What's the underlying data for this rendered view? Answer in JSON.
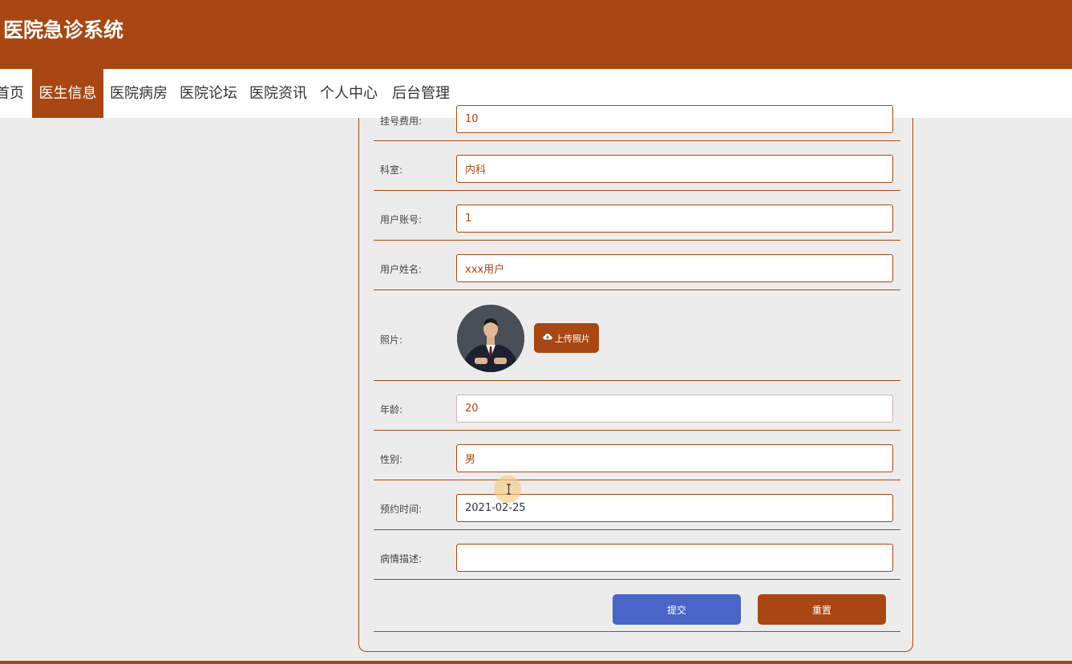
{
  "site": {
    "title": "医院急诊系统"
  },
  "nav": {
    "items": [
      {
        "label": "首页"
      },
      {
        "label": "医生信息",
        "active": true
      },
      {
        "label": "医院病房"
      },
      {
        "label": "医院论坛"
      },
      {
        "label": "医院资讯"
      },
      {
        "label": "个人中心"
      },
      {
        "label": "后台管理"
      }
    ]
  },
  "form": {
    "fee": {
      "label": "挂号费用:",
      "value": "10"
    },
    "department": {
      "label": "科室:",
      "value": "内科"
    },
    "account": {
      "label": "用户账号:",
      "value": "1"
    },
    "username": {
      "label": "用户姓名:",
      "value": "xxx用户"
    },
    "photo": {
      "label": "照片:",
      "upload_label": "上传照片",
      "icon": "cloud-upload-icon"
    },
    "age": {
      "label": "年龄:",
      "value": "20"
    },
    "gender": {
      "label": "性别:",
      "value": "男"
    },
    "appointment": {
      "label": "预约时间:",
      "value": "2021-02-25"
    },
    "description": {
      "label": "病情描述:",
      "value": ""
    },
    "submit_label": "提交",
    "reset_label": "重置"
  },
  "colors": {
    "brand": "#a84713",
    "submit": "#4a64c8",
    "background": "#ececec"
  }
}
